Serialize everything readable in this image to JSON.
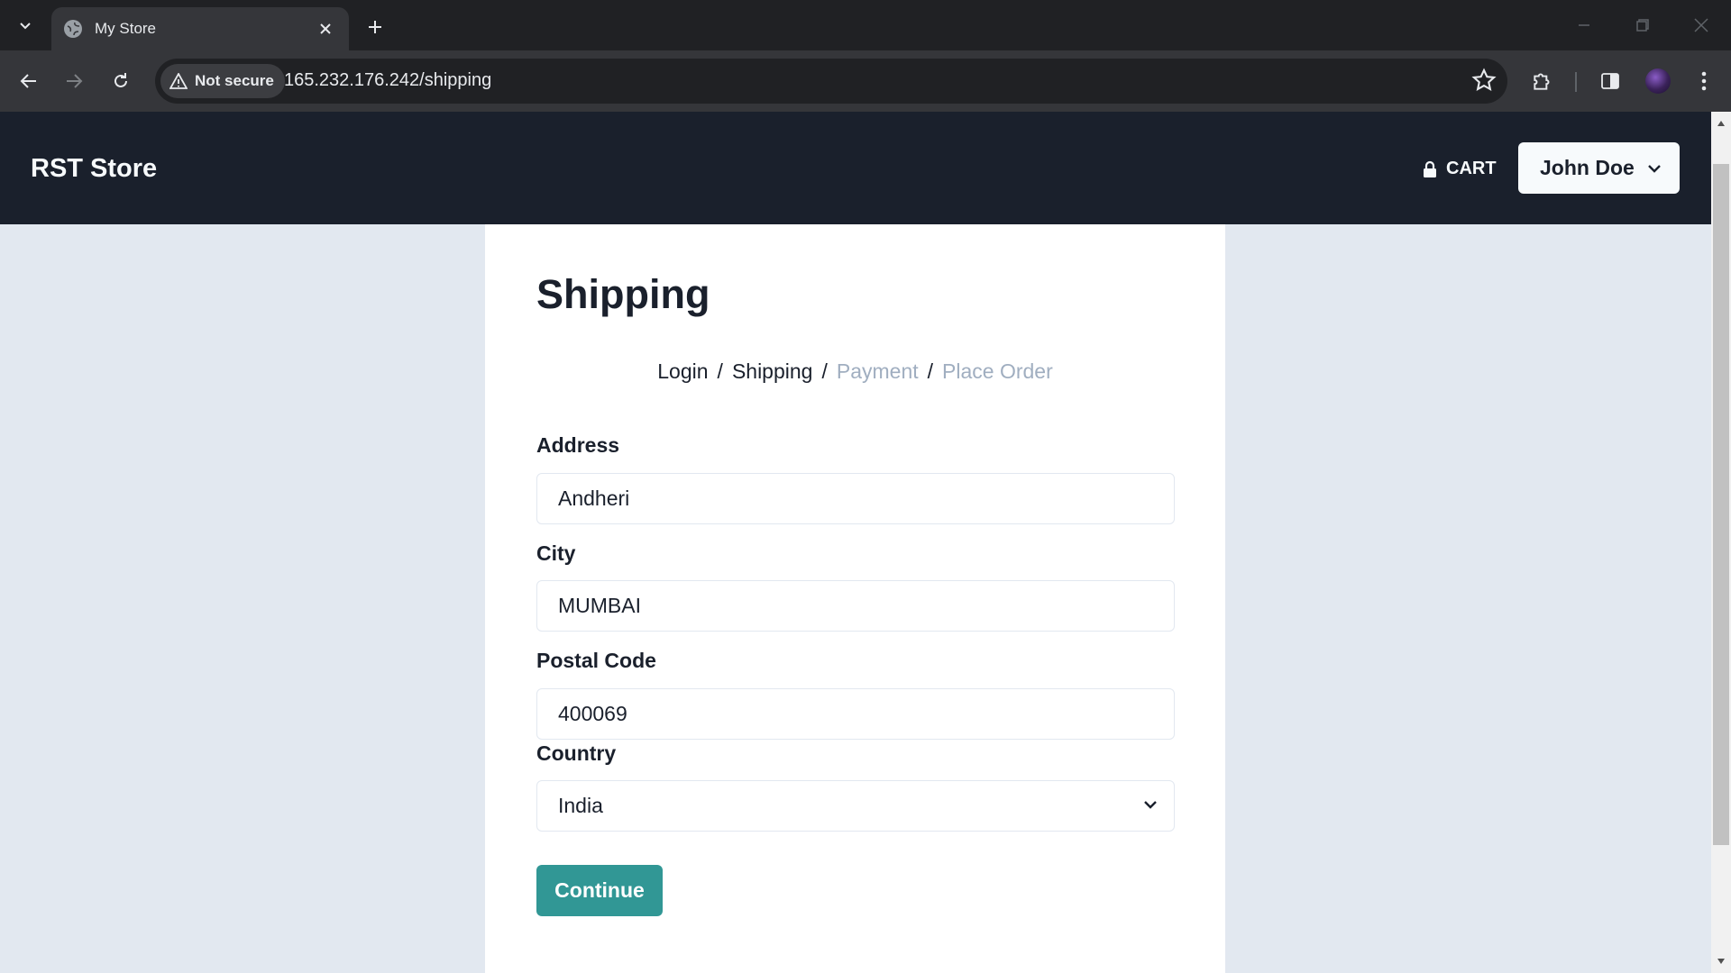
{
  "browser": {
    "tab_title": "My Store",
    "security_label": "Not secure",
    "url": "165.232.176.242/shipping"
  },
  "navbar": {
    "brand": "RST Store",
    "cart_label": "CART",
    "user_name": "John Doe"
  },
  "page": {
    "title": "Shipping",
    "steps": [
      {
        "label": "Login",
        "active": true
      },
      {
        "label": "Shipping",
        "active": true
      },
      {
        "label": "Payment",
        "active": false
      },
      {
        "label": "Place Order",
        "active": false
      }
    ],
    "separator": "/"
  },
  "form": {
    "address": {
      "label": "Address",
      "value": "Andheri"
    },
    "city": {
      "label": "City",
      "value": "MUMBAI"
    },
    "postal_code": {
      "label": "Postal Code",
      "value": "400069"
    },
    "country": {
      "label": "Country",
      "value": "India"
    },
    "submit_label": "Continue"
  },
  "icons": {
    "tab_search": "chevron-down-icon",
    "favicon": "globe-icon",
    "tab_close": "close-icon",
    "new_tab": "plus-icon",
    "back": "arrow-left-icon",
    "forward": "arrow-right-icon",
    "reload": "reload-icon",
    "warning": "warning-icon",
    "bookmark": "star-icon",
    "extensions": "puzzle-icon",
    "side_panel": "side-panel-icon",
    "menu": "kebab-menu-icon",
    "cart": "lock-icon",
    "user_dropdown": "chevron-down-icon",
    "select": "chevron-down-icon"
  },
  "colors": {
    "navbar_bg": "#1a202c",
    "page_bg": "#e2e8f0",
    "accent": "#319795",
    "muted": "#a0aec0"
  }
}
